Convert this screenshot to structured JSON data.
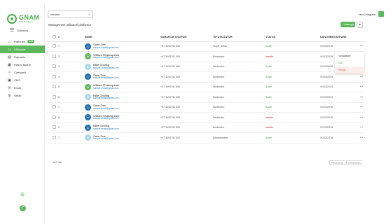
{
  "sidebar": {
    "logo_name": "GNAM",
    "logo_sub": "food & delivery",
    "menu_label": "Schimba",
    "items": [
      {
        "label": "Parteneri",
        "badge": "120",
        "icon": "store-icon"
      },
      {
        "label": "Utilizatori",
        "badge": "",
        "icon": "users-icon",
        "active": true
      },
      {
        "label": "Rapoarte",
        "badge": "",
        "icon": "report-icon"
      },
      {
        "label": "Plati si facturi",
        "badge": "",
        "icon": "invoice-icon"
      },
      {
        "label": "Campanii",
        "badge": "",
        "icon": "campaign-icon"
      },
      {
        "label": "CMS",
        "badge": "",
        "icon": "cms-icon"
      },
      {
        "label": "Email",
        "badge": "",
        "icon": "mail-icon"
      },
      {
        "label": "Setari",
        "badge": "",
        "icon": "settings-icon"
      }
    ]
  },
  "topbar": {
    "search_value": "cautare",
    "user_name": "user integrate"
  },
  "card": {
    "title": "Management utilizatori platforma",
    "add_label": "+ Adauga",
    "filter_icon": "filter-icon"
  },
  "table": {
    "headers": [
      "#",
      "NUME",
      "NUMAR DE TELEFON",
      "TIP UTILIZATOR",
      "STATUS",
      "DATA INREGISTRARE"
    ],
    "rows": [
      {
        "n": "1",
        "name": "Sahe Dee",
        "email": "sample.email@gmail.com",
        "phone": "+07 3493742 800",
        "type": "Super admin",
        "status": "Activ",
        "status_color": "#5cb85c",
        "date": "01/03/2019",
        "avatar": "#1f6fb2",
        "avatar_text": "S"
      },
      {
        "n": "2",
        "name": "William Shakespeare",
        "email": "sample.email@gmail.com",
        "phone": "+07 3493742 800",
        "type": "Moderator",
        "status": "Inactiv",
        "status_color": "#e05a5a",
        "date": "01/03/2019",
        "avatar": "#5cb85c",
        "avatar_text": "W"
      },
      {
        "n": "3",
        "name": "Billie Gosling",
        "email": "sample.email@gmail.com",
        "phone": "+07 3493742 800",
        "type": "Moderator",
        "status": "Activ",
        "status_color": "#5cb85c",
        "date": "01/03/2019",
        "avatar": "#a8d9ea",
        "avatar_text": "B"
      },
      {
        "n": "4",
        "name": "Sahe Dee",
        "email": "sample.email@gmail.com",
        "phone": "+07 3493742 800",
        "type": "Moderator",
        "status": "Activ",
        "status_color": "#5cb85c",
        "date": "01/03/2019",
        "avatar": "#1f6fb2",
        "avatar_text": "S"
      },
      {
        "n": "5",
        "name": "William Shakespeare",
        "email": "sample.email@gmail.com",
        "phone": "+07 3493742 800",
        "type": "Moderator",
        "status": "Activ",
        "status_color": "#5cb85c",
        "date": "01/03/2019",
        "avatar": "#5cb85c",
        "avatar_text": "W"
      },
      {
        "n": "6",
        "name": "Billie Gosling",
        "email": "sample.email@gmail.com",
        "phone": "+07 3493742 800",
        "type": "Moderator",
        "status": "Activ",
        "status_color": "#5cb85c",
        "date": "01/03/2019",
        "avatar": "#a8d9ea",
        "avatar_text": "B"
      },
      {
        "n": "7",
        "name": "Sahe Dee",
        "email": "sample.email@gmail.com",
        "phone": "+07 3493742 800",
        "type": "Moderator",
        "status": "Activ",
        "status_color": "#5cb85c",
        "date": "01/03/2019",
        "avatar": "#1f6fb2",
        "avatar_text": "S"
      },
      {
        "n": "8",
        "name": "William Shakespeare",
        "email": "sample.email@gmail.com",
        "phone": "+07 3493742 800",
        "type": "Moderator",
        "status": "Inactiv",
        "status_color": "#e05a5a",
        "date": "01/03/2019",
        "avatar": "#1f6fb2",
        "avatar_text": "W"
      },
      {
        "n": "9",
        "name": "Billie Gosling",
        "email": "sample.email@gmail.com",
        "phone": "+07 3493742 800",
        "type": "Moderator",
        "status": "Inactiv",
        "status_color": "#e05a5a",
        "date": "01/03/2019",
        "avatar": "#1f6fb2",
        "avatar_text": "B"
      },
      {
        "n": "7",
        "name": "Sahe Dee",
        "email": "sample.email@gmail.com",
        "phone": "+07 3493742 800",
        "type": "Administrator",
        "status": "Activ",
        "status_color": "#5cb85c",
        "date": "01/03/2019",
        "avatar": "#a8d9ea",
        "avatar_text": "S"
      }
    ]
  },
  "footer": {
    "count": "10 / 100",
    "prev": "Precedenta",
    "next": "Urmatoarea"
  },
  "context_menu": {
    "items": [
      "Vizualizare",
      "Edit",
      "Sterge"
    ]
  }
}
